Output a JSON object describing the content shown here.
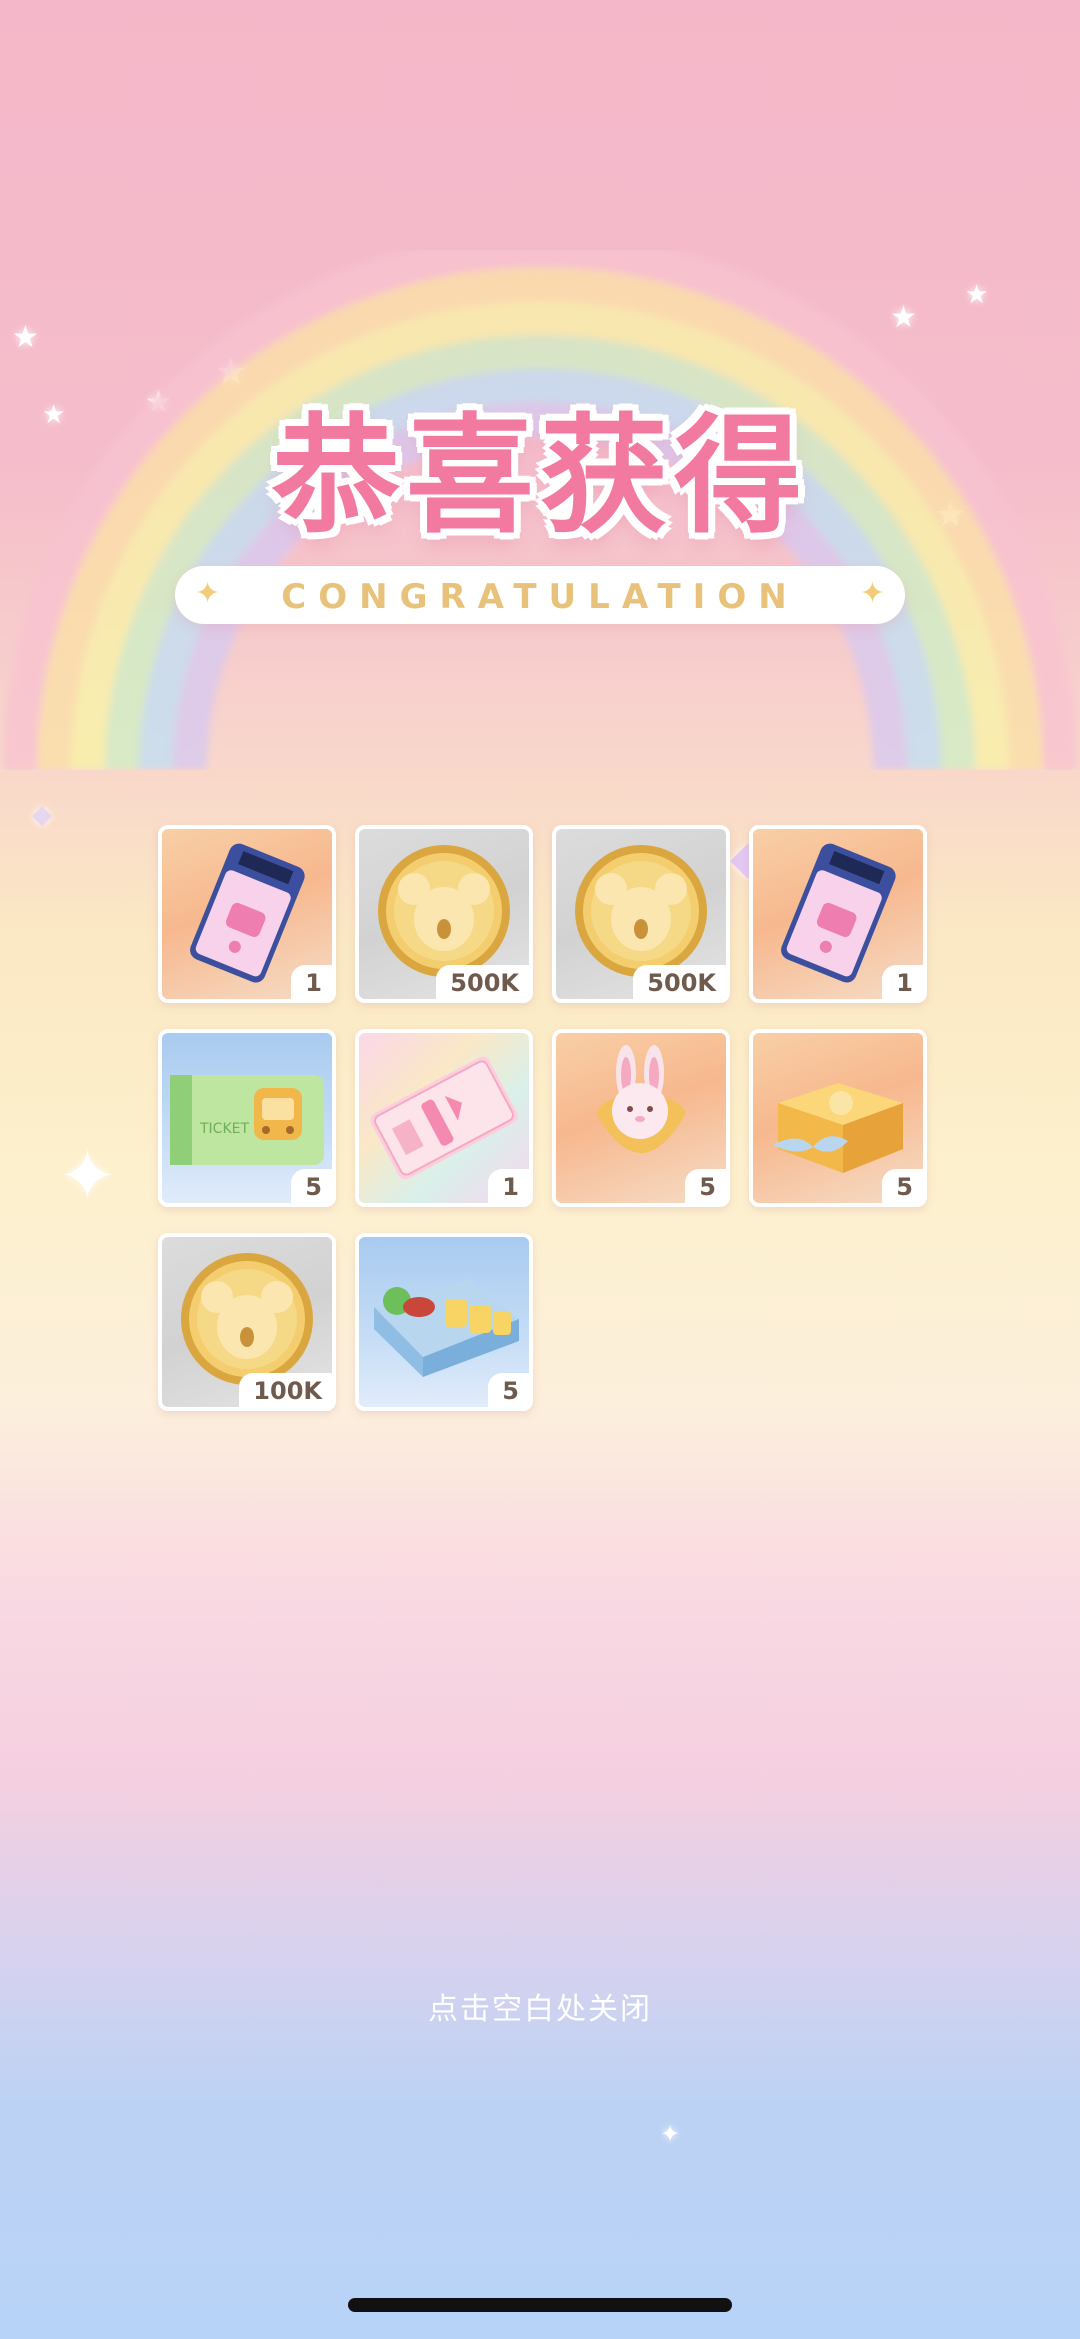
{
  "title": {
    "main": "恭喜获得",
    "sub": "CONGRATULATION"
  },
  "rewards": [
    {
      "name": "ticket",
      "count": "1",
      "bg": "peach"
    },
    {
      "name": "koala-coin",
      "count": "500K",
      "bg": "grey"
    },
    {
      "name": "koala-coin",
      "count": "500K",
      "bg": "grey"
    },
    {
      "name": "ticket",
      "count": "1",
      "bg": "peach"
    },
    {
      "name": "green-ticket",
      "count": "5",
      "bg": "blue"
    },
    {
      "name": "pink-voucher",
      "count": "1",
      "bg": "rainbow"
    },
    {
      "name": "bunny-pouch",
      "count": "5",
      "bg": "peach"
    },
    {
      "name": "gift-box",
      "count": "5",
      "bg": "peach"
    },
    {
      "name": "koala-coin",
      "count": "100K",
      "bg": "grey"
    },
    {
      "name": "bento-box",
      "count": "5",
      "bg": "blue"
    }
  ],
  "green_ticket_label": "TICKET",
  "close_hint": "点击空白处关闭",
  "colors": {
    "title_pink": "#f27aa0",
    "title_gold": "#e8c27a",
    "count_text": "#6e5b4d"
  }
}
